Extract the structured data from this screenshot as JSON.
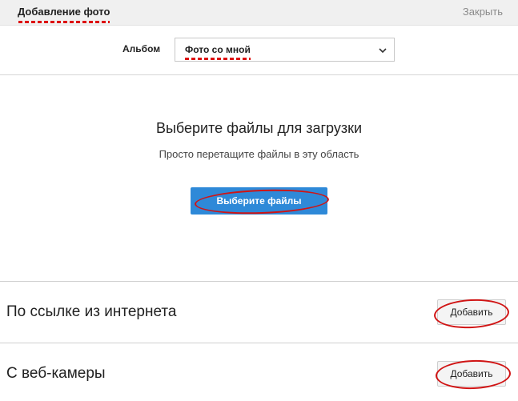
{
  "dialog": {
    "title": "Добавление фото",
    "close_label": "Закрыть"
  },
  "album": {
    "label": "Альбом",
    "selected": "Фото со мной"
  },
  "upload": {
    "heading": "Выберите файлы для загрузки",
    "hint": "Просто перетащите файлы в эту область",
    "button_label": "Выберите файлы"
  },
  "from_link": {
    "label": "По ссылке из интернета",
    "button_label": "Добавить"
  },
  "from_webcam": {
    "label": "С веб-камеры",
    "button_label": "Добавить"
  },
  "colors": {
    "primary_button": "#2e89d8",
    "annotation_red": "#d01414"
  },
  "icons": {
    "album_dropdown": "chevron-down-icon"
  }
}
